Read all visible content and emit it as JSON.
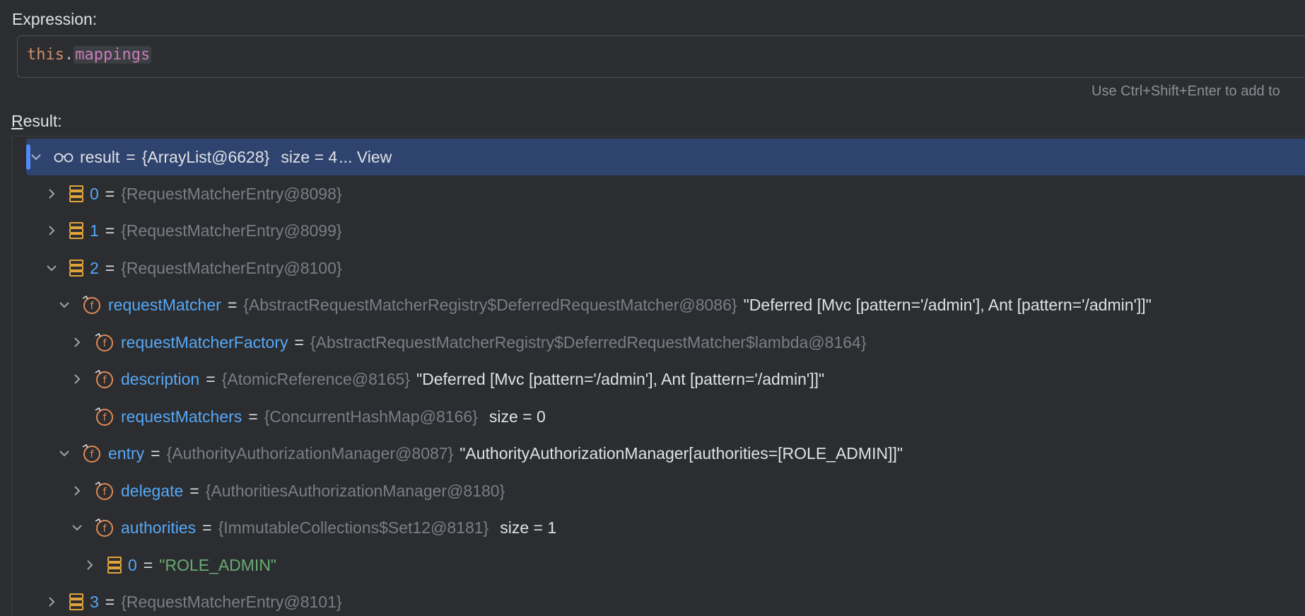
{
  "expression": {
    "label": "Expression:",
    "keyword": "this",
    "dot": ".",
    "field": "mappings"
  },
  "hint": "Use Ctrl+Shift+Enter to add to",
  "result_label_u": "R",
  "result_label_rest": "esult:",
  "result_row": {
    "name": "result",
    "eq": "=",
    "value": "{ArrayList@6628}",
    "size": "size = 4",
    "view": "... View"
  },
  "tree": [
    {
      "name": "0",
      "value": "{RequestMatcherEntry@8098}"
    },
    {
      "name": "1",
      "value": "{RequestMatcherEntry@8099}"
    },
    {
      "name": "2",
      "value": "{RequestMatcherEntry@8100}"
    },
    {
      "name": "requestMatcher",
      "value": "{AbstractRequestMatcherRegistry$DeferredRequestMatcher@8086}",
      "str": "\"Deferred [Mvc [pattern='/admin'], Ant [pattern='/admin']]\""
    },
    {
      "name": "requestMatcherFactory",
      "value": "{AbstractRequestMatcherRegistry$DeferredRequestMatcher$lambda@8164}"
    },
    {
      "name": "description",
      "value": "{AtomicReference@8165}",
      "str": "\"Deferred [Mvc [pattern='/admin'], Ant [pattern='/admin']]\""
    },
    {
      "name": "requestMatchers",
      "value": "{ConcurrentHashMap@8166}",
      "size": "size = 0"
    },
    {
      "name": "entry",
      "value": "{AuthorityAuthorizationManager@8087}",
      "str": "\"AuthorityAuthorizationManager[authorities=[ROLE_ADMIN]]\""
    },
    {
      "name": "delegate",
      "value": "{AuthoritiesAuthorizationManager@8180}"
    },
    {
      "name": "authorities",
      "value": "{ImmutableCollections$Set12@8181}",
      "size": "size = 1"
    },
    {
      "name": "0",
      "strval": "\"ROLE_ADMIN\""
    },
    {
      "name": "3",
      "value": "{RequestMatcherEntry@8101}"
    }
  ],
  "colors": {
    "background": "#2b2d30",
    "selection": "#2e436e",
    "name": "#56a8f5",
    "object": "#7a7e85",
    "string": "#6aab73",
    "keyword": "#cf8e6d",
    "field": "#c77dbb"
  },
  "icons": {
    "array_element": "array-element-icon",
    "field": "field-icon",
    "watch": "glasses-icon"
  }
}
